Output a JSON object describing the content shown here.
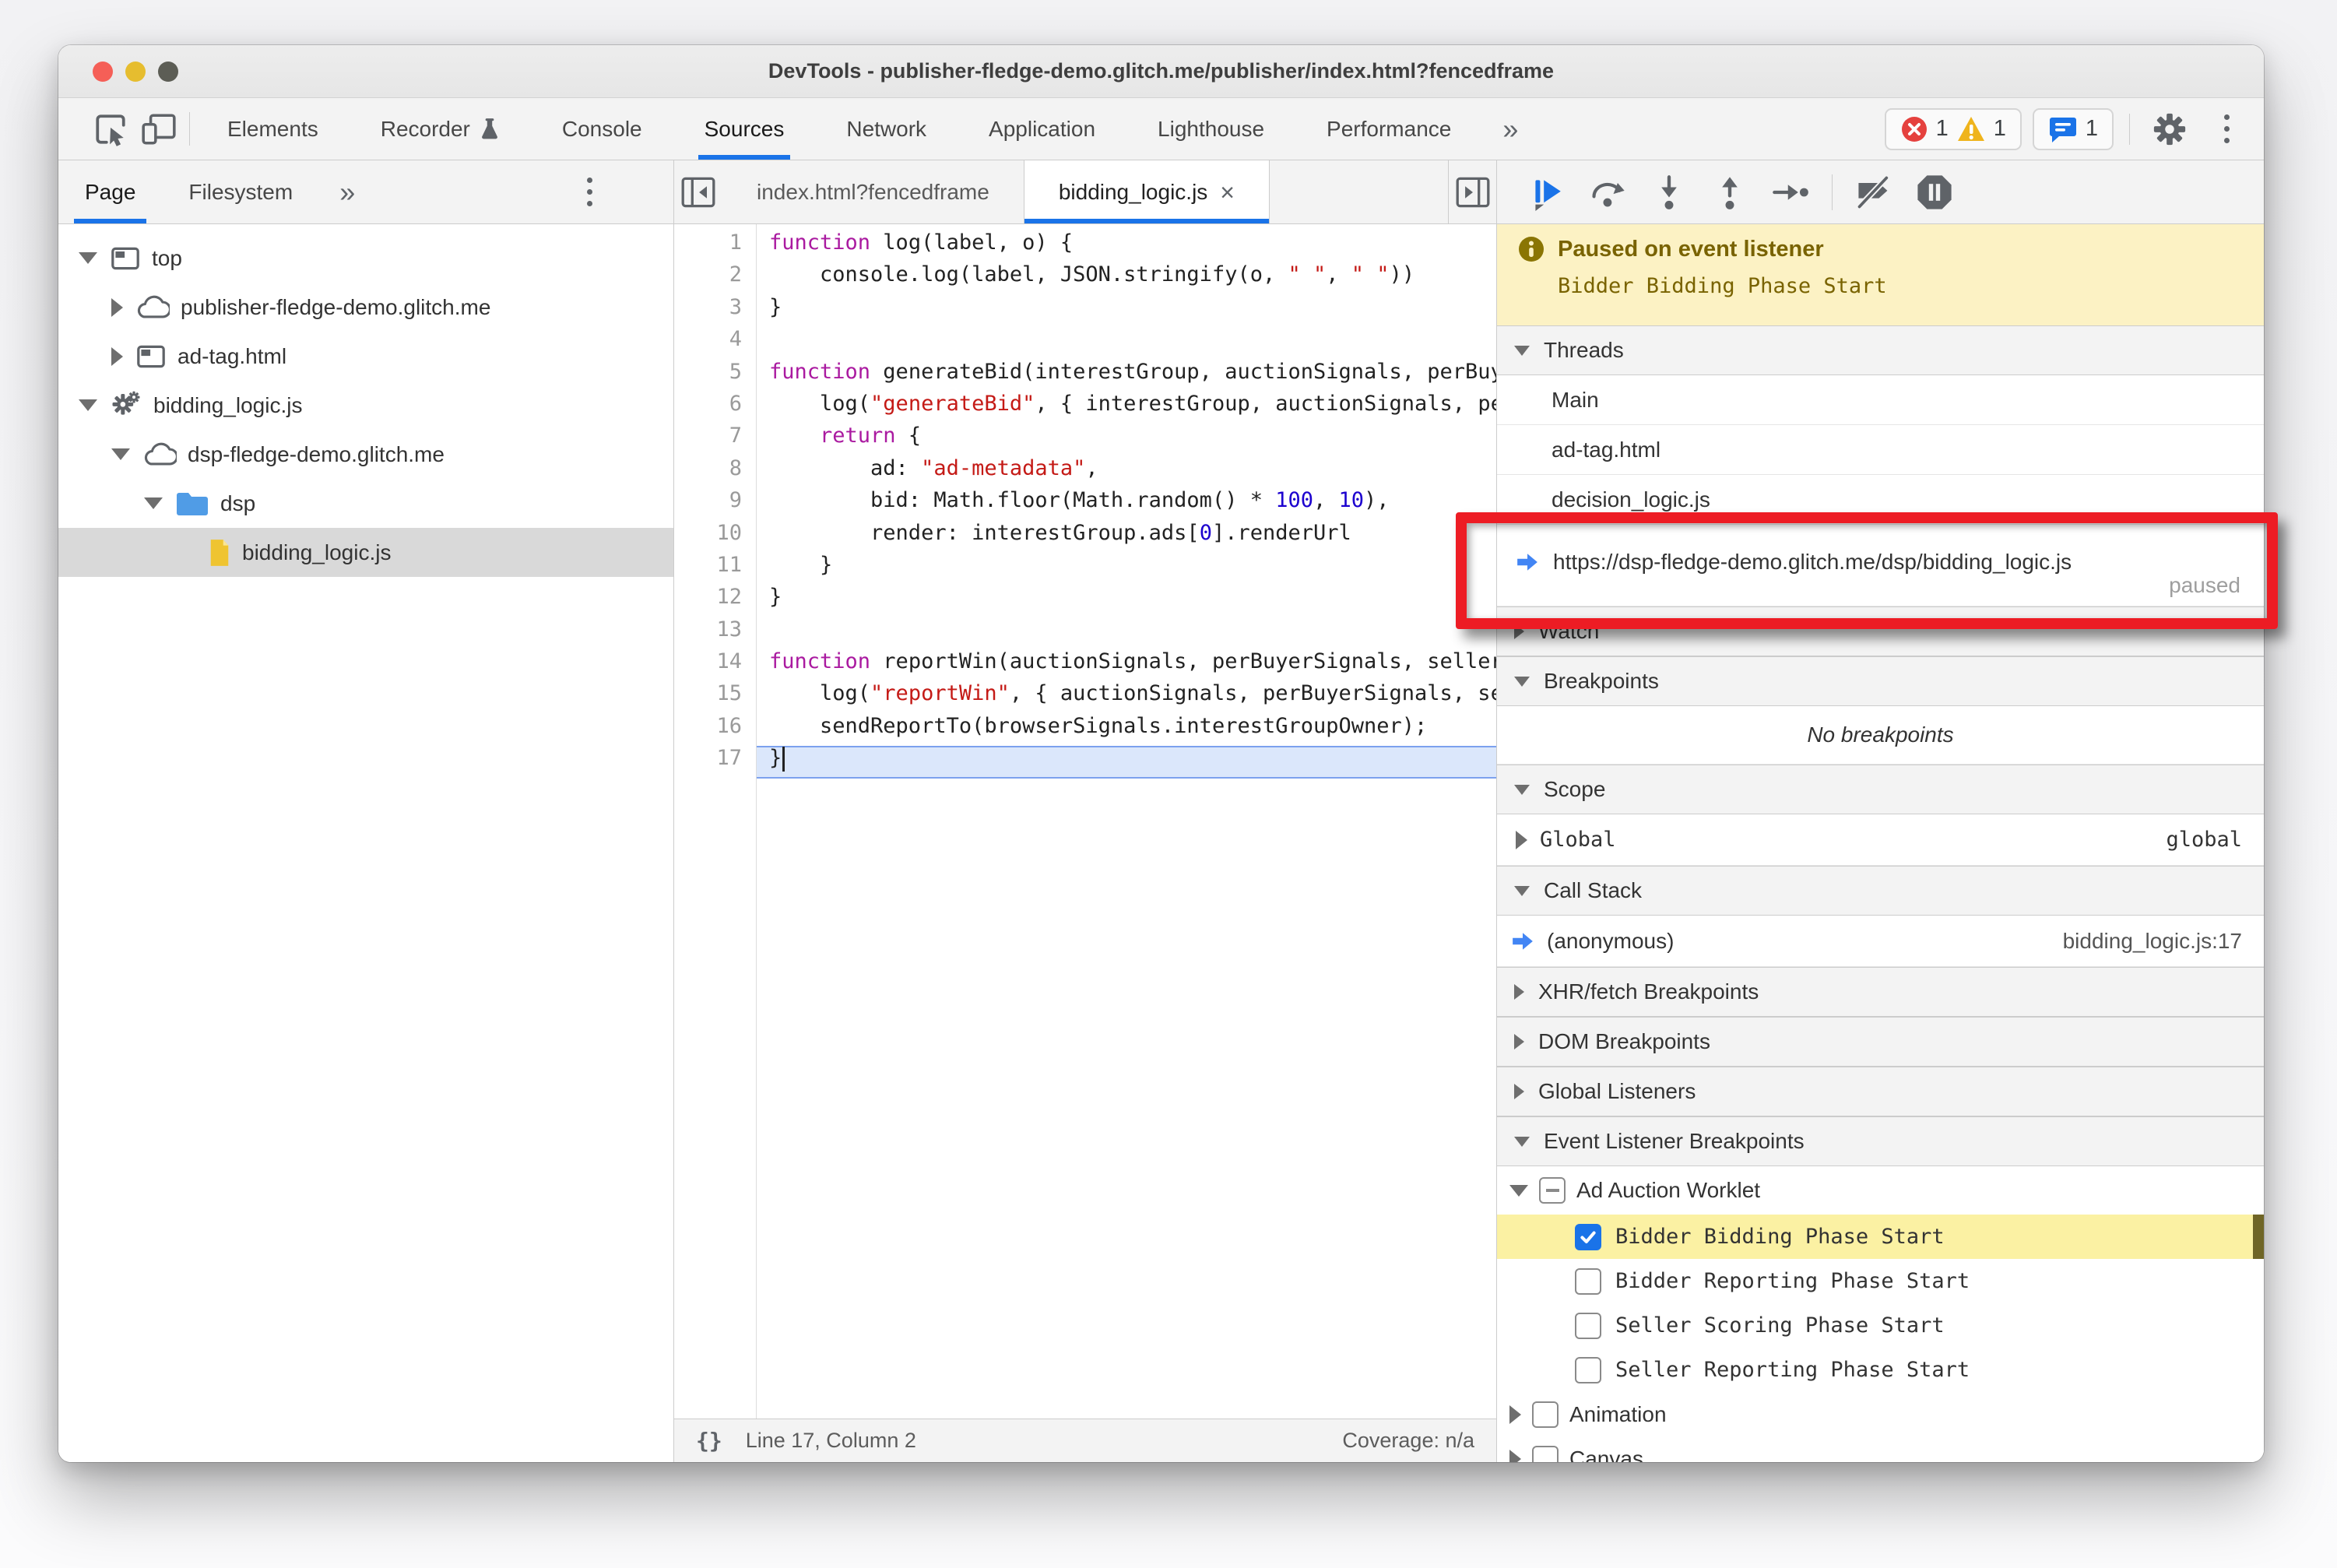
{
  "colors": {
    "accent": "#1a73e8",
    "annotation_red": "#ed1c24",
    "exec_arrow": "#4285f4",
    "banner_bg": "#fcf2c4",
    "banner_text": "#796300",
    "highlight_row": "#fbf1a3",
    "folder_blue": "#509ce6",
    "file_yellow": "#efc431",
    "error_red": "#e5413e",
    "warning_yellow": "#efb41c",
    "message_blue": "#1a73e8",
    "paused_line": "#dbe7fb"
  },
  "window": {
    "title": "DevTools - publisher-fledge-demo.glitch.me/publisher/index.html?fencedframe"
  },
  "tabbar": {
    "tabs": [
      {
        "label": "Elements"
      },
      {
        "label": "Recorder",
        "icon": "flask"
      },
      {
        "label": "Console"
      },
      {
        "label": "Sources"
      },
      {
        "label": "Network"
      },
      {
        "label": "Application"
      },
      {
        "label": "Lighthouse"
      },
      {
        "label": "Performance"
      }
    ],
    "active": "Sources",
    "more": "»",
    "error_count": "1",
    "warning_count": "1",
    "message_count": "1"
  },
  "sidebar": {
    "tabs": [
      "Page",
      "Filesystem"
    ],
    "active": "Page",
    "more": "»",
    "tree": [
      {
        "depth": 0,
        "arrow": "open",
        "icon": "frame",
        "label": "top"
      },
      {
        "depth": 1,
        "arrow": "closed",
        "icon": "cloud",
        "label": "publisher-fledge-demo.glitch.me"
      },
      {
        "depth": 1,
        "arrow": "closed",
        "icon": "frame",
        "label": "ad-tag.html"
      },
      {
        "depth": 0,
        "arrow": "open",
        "icon": "worker",
        "label": "bidding_logic.js"
      },
      {
        "depth": 1,
        "arrow": "open",
        "icon": "cloud",
        "label": "dsp-fledge-demo.glitch.me"
      },
      {
        "depth": 2,
        "arrow": "open",
        "icon": "folder",
        "label": "dsp"
      },
      {
        "depth": 3,
        "arrow": "none",
        "icon": "file",
        "label": "bidding_logic.js",
        "selected": true
      }
    ]
  },
  "editor": {
    "tabs": [
      {
        "label": "index.html?fencedframe",
        "active": false
      },
      {
        "label": "bidding_logic.js",
        "active": true,
        "close": "×"
      }
    ],
    "lines": [
      {
        "n": 1,
        "segs": [
          [
            "kw",
            "function"
          ],
          [
            "def",
            " log(label, o) {"
          ]
        ]
      },
      {
        "n": 2,
        "segs": [
          [
            "def",
            "    console.log(label, JSON.stringify(o, "
          ],
          [
            "str",
            "\" \""
          ],
          [
            "def",
            ", "
          ],
          [
            "str",
            "\" \""
          ],
          [
            "def",
            "))"
          ]
        ]
      },
      {
        "n": 3,
        "segs": [
          [
            "def",
            "}"
          ]
        ]
      },
      {
        "n": 4,
        "segs": []
      },
      {
        "n": 5,
        "segs": [
          [
            "kw",
            "function"
          ],
          [
            "def",
            " generateBid(interestGroup, auctionSignals, perBuyerSignals, trustedBiddingSignals, browserSignals) {"
          ]
        ]
      },
      {
        "n": 6,
        "segs": [
          [
            "def",
            "    log("
          ],
          [
            "str",
            "\"generateBid\""
          ],
          [
            "def",
            ", { interestGroup, auctionSignals, perBuyerSignals, browserSignals });"
          ]
        ]
      },
      {
        "n": 7,
        "segs": [
          [
            "def",
            "    "
          ],
          [
            "kw",
            "return"
          ],
          [
            "def",
            " {"
          ]
        ]
      },
      {
        "n": 8,
        "segs": [
          [
            "def",
            "        ad: "
          ],
          [
            "str",
            "\"ad-metadata\""
          ],
          [
            "def",
            ","
          ]
        ]
      },
      {
        "n": 9,
        "segs": [
          [
            "def",
            "        bid: Math.floor(Math.random() * "
          ],
          [
            "num",
            "100"
          ],
          [
            "def",
            ", "
          ],
          [
            "num",
            "10"
          ],
          [
            "def",
            "),"
          ]
        ]
      },
      {
        "n": 10,
        "segs": [
          [
            "def",
            "        render: interestGroup.ads["
          ],
          [
            "num",
            "0"
          ],
          [
            "def",
            "].renderUrl"
          ]
        ]
      },
      {
        "n": 11,
        "segs": [
          [
            "def",
            "    }"
          ]
        ]
      },
      {
        "n": 12,
        "segs": [
          [
            "def",
            "}"
          ]
        ]
      },
      {
        "n": 13,
        "segs": []
      },
      {
        "n": 14,
        "segs": [
          [
            "kw",
            "function"
          ],
          [
            "def",
            " reportWin(auctionSignals, perBuyerSignals, sellerSignals, browserSignals) {"
          ]
        ]
      },
      {
        "n": 15,
        "segs": [
          [
            "def",
            "    log("
          ],
          [
            "str",
            "\"reportWin\""
          ],
          [
            "def",
            ", { auctionSignals, perBuyerSignals, sellerSignals, browserSignals });"
          ]
        ]
      },
      {
        "n": 16,
        "segs": [
          [
            "def",
            "    sendReportTo(browserSignals.interestGroupOwner);"
          ]
        ]
      },
      {
        "n": 17,
        "segs": [
          [
            "def",
            "}"
          ]
        ],
        "exec": true
      }
    ],
    "status": {
      "pretty_print": "{}",
      "line_col": "Line 17, Column 2",
      "coverage": "Coverage: n/a"
    }
  },
  "debugger": {
    "paused_title": "Paused on event listener",
    "paused_detail": "Bidder Bidding Phase Start",
    "sections": [
      {
        "type": "header",
        "id": "threads",
        "label": "Threads",
        "state": "open"
      },
      {
        "type": "thread",
        "label": "Main"
      },
      {
        "type": "thread",
        "label": "ad-tag.html"
      },
      {
        "type": "thread",
        "label": "decision_logic.js"
      },
      {
        "type": "thread-paused",
        "label": "https://dsp-fledge-demo.glitch.me/dsp/bidding_logic.js",
        "badge": "paused"
      },
      {
        "type": "header",
        "id": "watch",
        "label": "Watch",
        "state": "closed"
      },
      {
        "type": "header",
        "id": "breakpoints",
        "label": "Breakpoints",
        "state": "open"
      },
      {
        "type": "empty",
        "label": "No breakpoints"
      },
      {
        "type": "header",
        "id": "scope",
        "label": "Scope",
        "state": "open"
      },
      {
        "type": "scope-row",
        "label": "Global",
        "value": "global"
      },
      {
        "type": "header",
        "id": "call-stack",
        "label": "Call Stack",
        "state": "open"
      },
      {
        "type": "stack-row",
        "label": "(anonymous)",
        "location": "bidding_logic.js:17"
      },
      {
        "type": "header",
        "id": "xhr-fetch-breakpoints",
        "label": "XHR/fetch Breakpoints",
        "state": "closed"
      },
      {
        "type": "header",
        "id": "dom-breakpoints",
        "label": "DOM Breakpoints",
        "state": "closed"
      },
      {
        "type": "header",
        "id": "global-listeners",
        "label": "Global Listeners",
        "state": "closed"
      },
      {
        "type": "header",
        "id": "event-listener-breakpoints",
        "label": "Event Listener Breakpoints",
        "state": "open"
      }
    ],
    "event_listener_tree": {
      "group": {
        "label": "Ad Auction Worklet",
        "checkbox": "indeterminate",
        "expanded": true
      },
      "items": [
        {
          "label": "Bidder Bidding Phase Start",
          "checked": true,
          "highlighted": true
        },
        {
          "label": "Bidder Reporting Phase Start",
          "checked": false
        },
        {
          "label": "Seller Scoring Phase Start",
          "checked": false
        },
        {
          "label": "Seller Reporting Phase Start",
          "checked": false
        }
      ],
      "siblings": [
        {
          "label": "Animation"
        },
        {
          "label": "Canvas"
        }
      ]
    }
  }
}
